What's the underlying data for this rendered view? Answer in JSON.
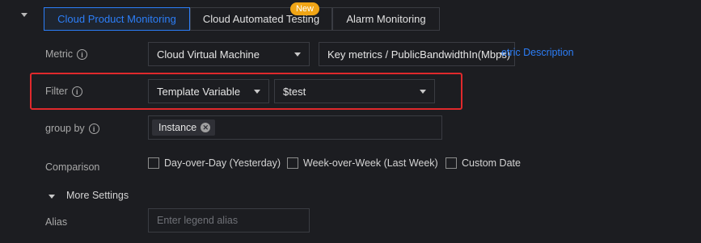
{
  "tabs": [
    {
      "label": "Cloud Product Monitoring",
      "active": true
    },
    {
      "label": "Cloud Automated Testing",
      "active": false,
      "badge": "New"
    },
    {
      "label": "Alarm Monitoring",
      "active": false
    }
  ],
  "metric": {
    "label": "Metric",
    "namespace_select": "Cloud Virtual Machine",
    "metric_select": "Key metrics / PublicBandwidthIn(Mbps)",
    "description_link": "etric Description"
  },
  "filter": {
    "label": "Filter",
    "type_select": "Template Variable",
    "value_select": "$test"
  },
  "group_by": {
    "label": "group by",
    "tags": [
      "Instance"
    ]
  },
  "comparison": {
    "label": "Comparison",
    "options": [
      {
        "label": "Day-over-Day (Yesterday)",
        "checked": false
      },
      {
        "label": "Week-over-Week (Last Week)",
        "checked": false
      },
      {
        "label": "Custom Date",
        "checked": false
      }
    ]
  },
  "more_settings": {
    "label": "More Settings"
  },
  "alias": {
    "label": "Alias",
    "placeholder": "Enter legend alias",
    "value": ""
  },
  "colors": {
    "accent": "#2c7ef8",
    "badge": "#f0a516",
    "highlight_border": "#e0292c",
    "background": "#1c1d21"
  }
}
